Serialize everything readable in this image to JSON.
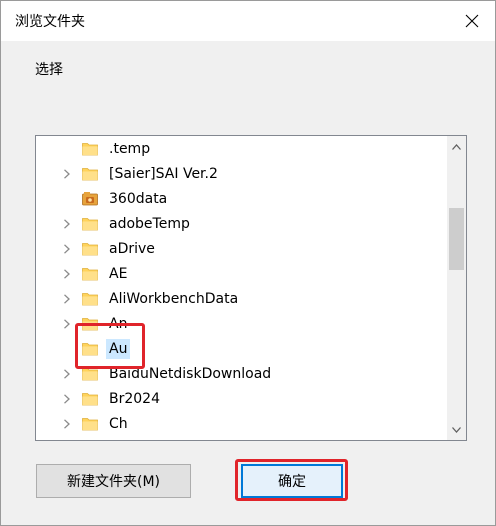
{
  "window": {
    "title": "浏览文件夹"
  },
  "prompt": "选择",
  "tree": {
    "items": [
      {
        "label": ".temp",
        "expandable": false,
        "icon": "folder-icon",
        "selected": false
      },
      {
        "label": "[Saier]SAI Ver.2",
        "expandable": true,
        "icon": "folder-icon",
        "selected": false
      },
      {
        "label": "360data",
        "expandable": false,
        "icon": "special-folder-icon",
        "selected": false
      },
      {
        "label": "adobeTemp",
        "expandable": true,
        "icon": "folder-icon",
        "selected": false
      },
      {
        "label": "aDrive",
        "expandable": true,
        "icon": "folder-icon",
        "selected": false
      },
      {
        "label": "AE",
        "expandable": true,
        "icon": "folder-icon",
        "selected": false
      },
      {
        "label": "AliWorkbenchData",
        "expandable": true,
        "icon": "folder-icon",
        "selected": false
      },
      {
        "label": "An",
        "expandable": true,
        "icon": "folder-icon",
        "selected": false
      },
      {
        "label": "Au",
        "expandable": false,
        "icon": "folder-icon",
        "selected": true
      },
      {
        "label": "BaiduNetdiskDownload",
        "expandable": true,
        "icon": "folder-icon",
        "selected": false
      },
      {
        "label": "Br2024",
        "expandable": true,
        "icon": "folder-icon",
        "selected": false
      },
      {
        "label": "Ch",
        "expandable": true,
        "icon": "folder-icon",
        "selected": false
      }
    ]
  },
  "buttons": {
    "new_folder": "新建文件夹(M)",
    "ok": "确定"
  },
  "colors": {
    "annotation_red": "#e0242a",
    "selection": "#cce8ff",
    "folder_yellow": "#ffd35c"
  }
}
